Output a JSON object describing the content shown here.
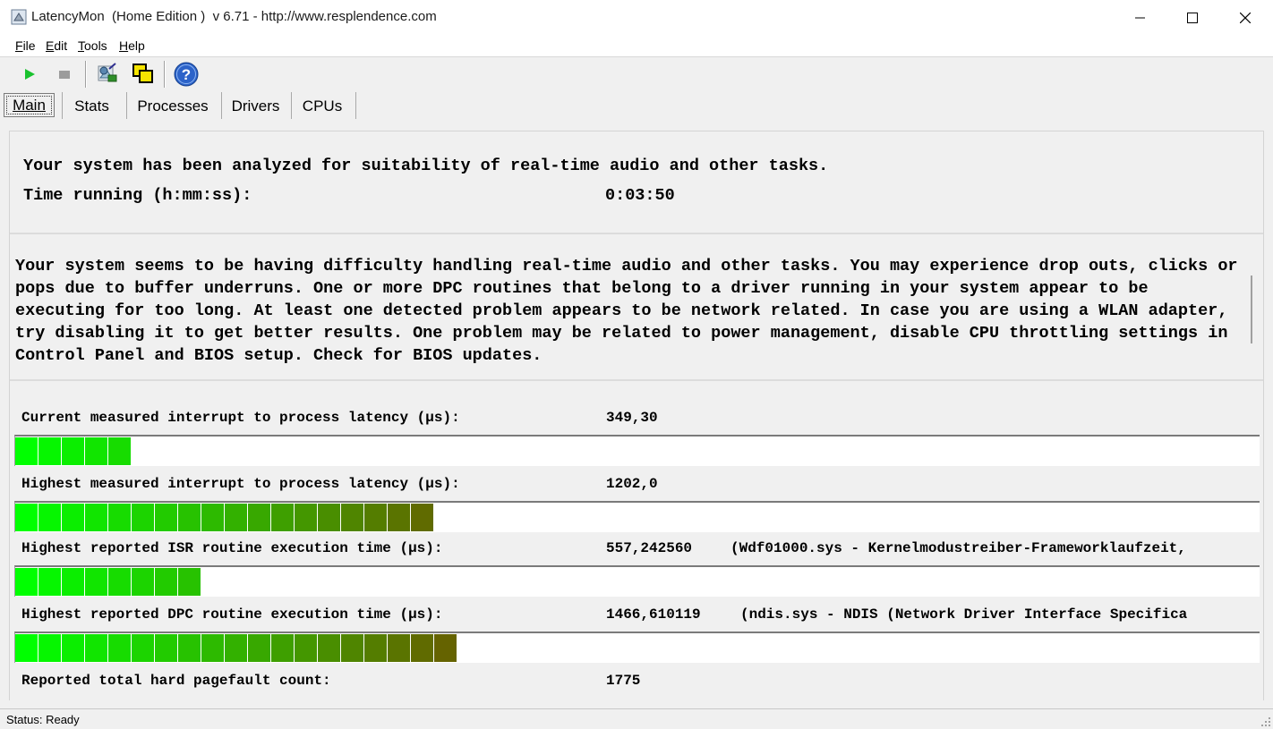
{
  "window": {
    "title": "LatencyMon  (Home Edition )  v 6.71 - http://www.resplendence.com"
  },
  "menu": {
    "items": [
      {
        "label": "File",
        "accel": "F"
      },
      {
        "label": "Edit",
        "accel": "E"
      },
      {
        "label": "Tools",
        "accel": "T"
      },
      {
        "label": "Help",
        "accel": "H"
      }
    ]
  },
  "toolbar": {
    "buttons": [
      {
        "icon": "play-icon"
      },
      {
        "icon": "stop-icon"
      },
      {
        "icon": "driver-settings-icon"
      },
      {
        "icon": "windows-icon"
      },
      {
        "icon": "help-icon"
      }
    ]
  },
  "tabs": [
    {
      "label": "Main",
      "active": true
    },
    {
      "label": "Stats",
      "active": false
    },
    {
      "label": "Processes",
      "active": false
    },
    {
      "label": "Drivers",
      "active": false
    },
    {
      "label": "CPUs",
      "active": false
    }
  ],
  "summary": {
    "line1": "Your system has been analyzed for suitability of real-time audio and other tasks.",
    "time_label": "Time running (h:mm:ss):",
    "time_value": "0:03:50"
  },
  "message": "Your system seems to be having difficulty handling real-time audio and other tasks. You may experience drop outs, clicks or pops due to buffer underruns. One or more DPC routines that belong to a driver running in your system appear to be executing for too long. At least one detected problem appears to be network related. In case you are using a WLAN adapter, try disabling it to get better results. One problem may be related to power management, disable CPU throttling settings in Control Panel and BIOS setup. Check for BIOS updates.",
  "metrics": [
    {
      "label": "Current measured interrupt to process latency (µs):",
      "value": "349,30",
      "detail": "",
      "segments": 5
    },
    {
      "label": "Highest measured interrupt to process latency (µs):",
      "value": "1202,0",
      "detail": "",
      "segments": 18
    },
    {
      "label": "Highest reported ISR routine execution time (µs):",
      "value": "557,242560",
      "detail": "(Wdf01000.sys - Kernelmodustreiber-Frameworklaufzeit,",
      "segments": 8
    },
    {
      "label": "Highest reported DPC routine execution time (µs):",
      "value": "1466,610119",
      "detail": "(ndis.sys - NDIS (Network Driver Interface Specifica",
      "segments": 19
    },
    {
      "label": "Reported total hard pagefault count:",
      "value": "1775",
      "detail": "",
      "segments": 0
    }
  ],
  "colors": {
    "bar_start": "#00ff00",
    "bar_end": "#6b5a00"
  },
  "status": {
    "text": "Status: Ready"
  }
}
